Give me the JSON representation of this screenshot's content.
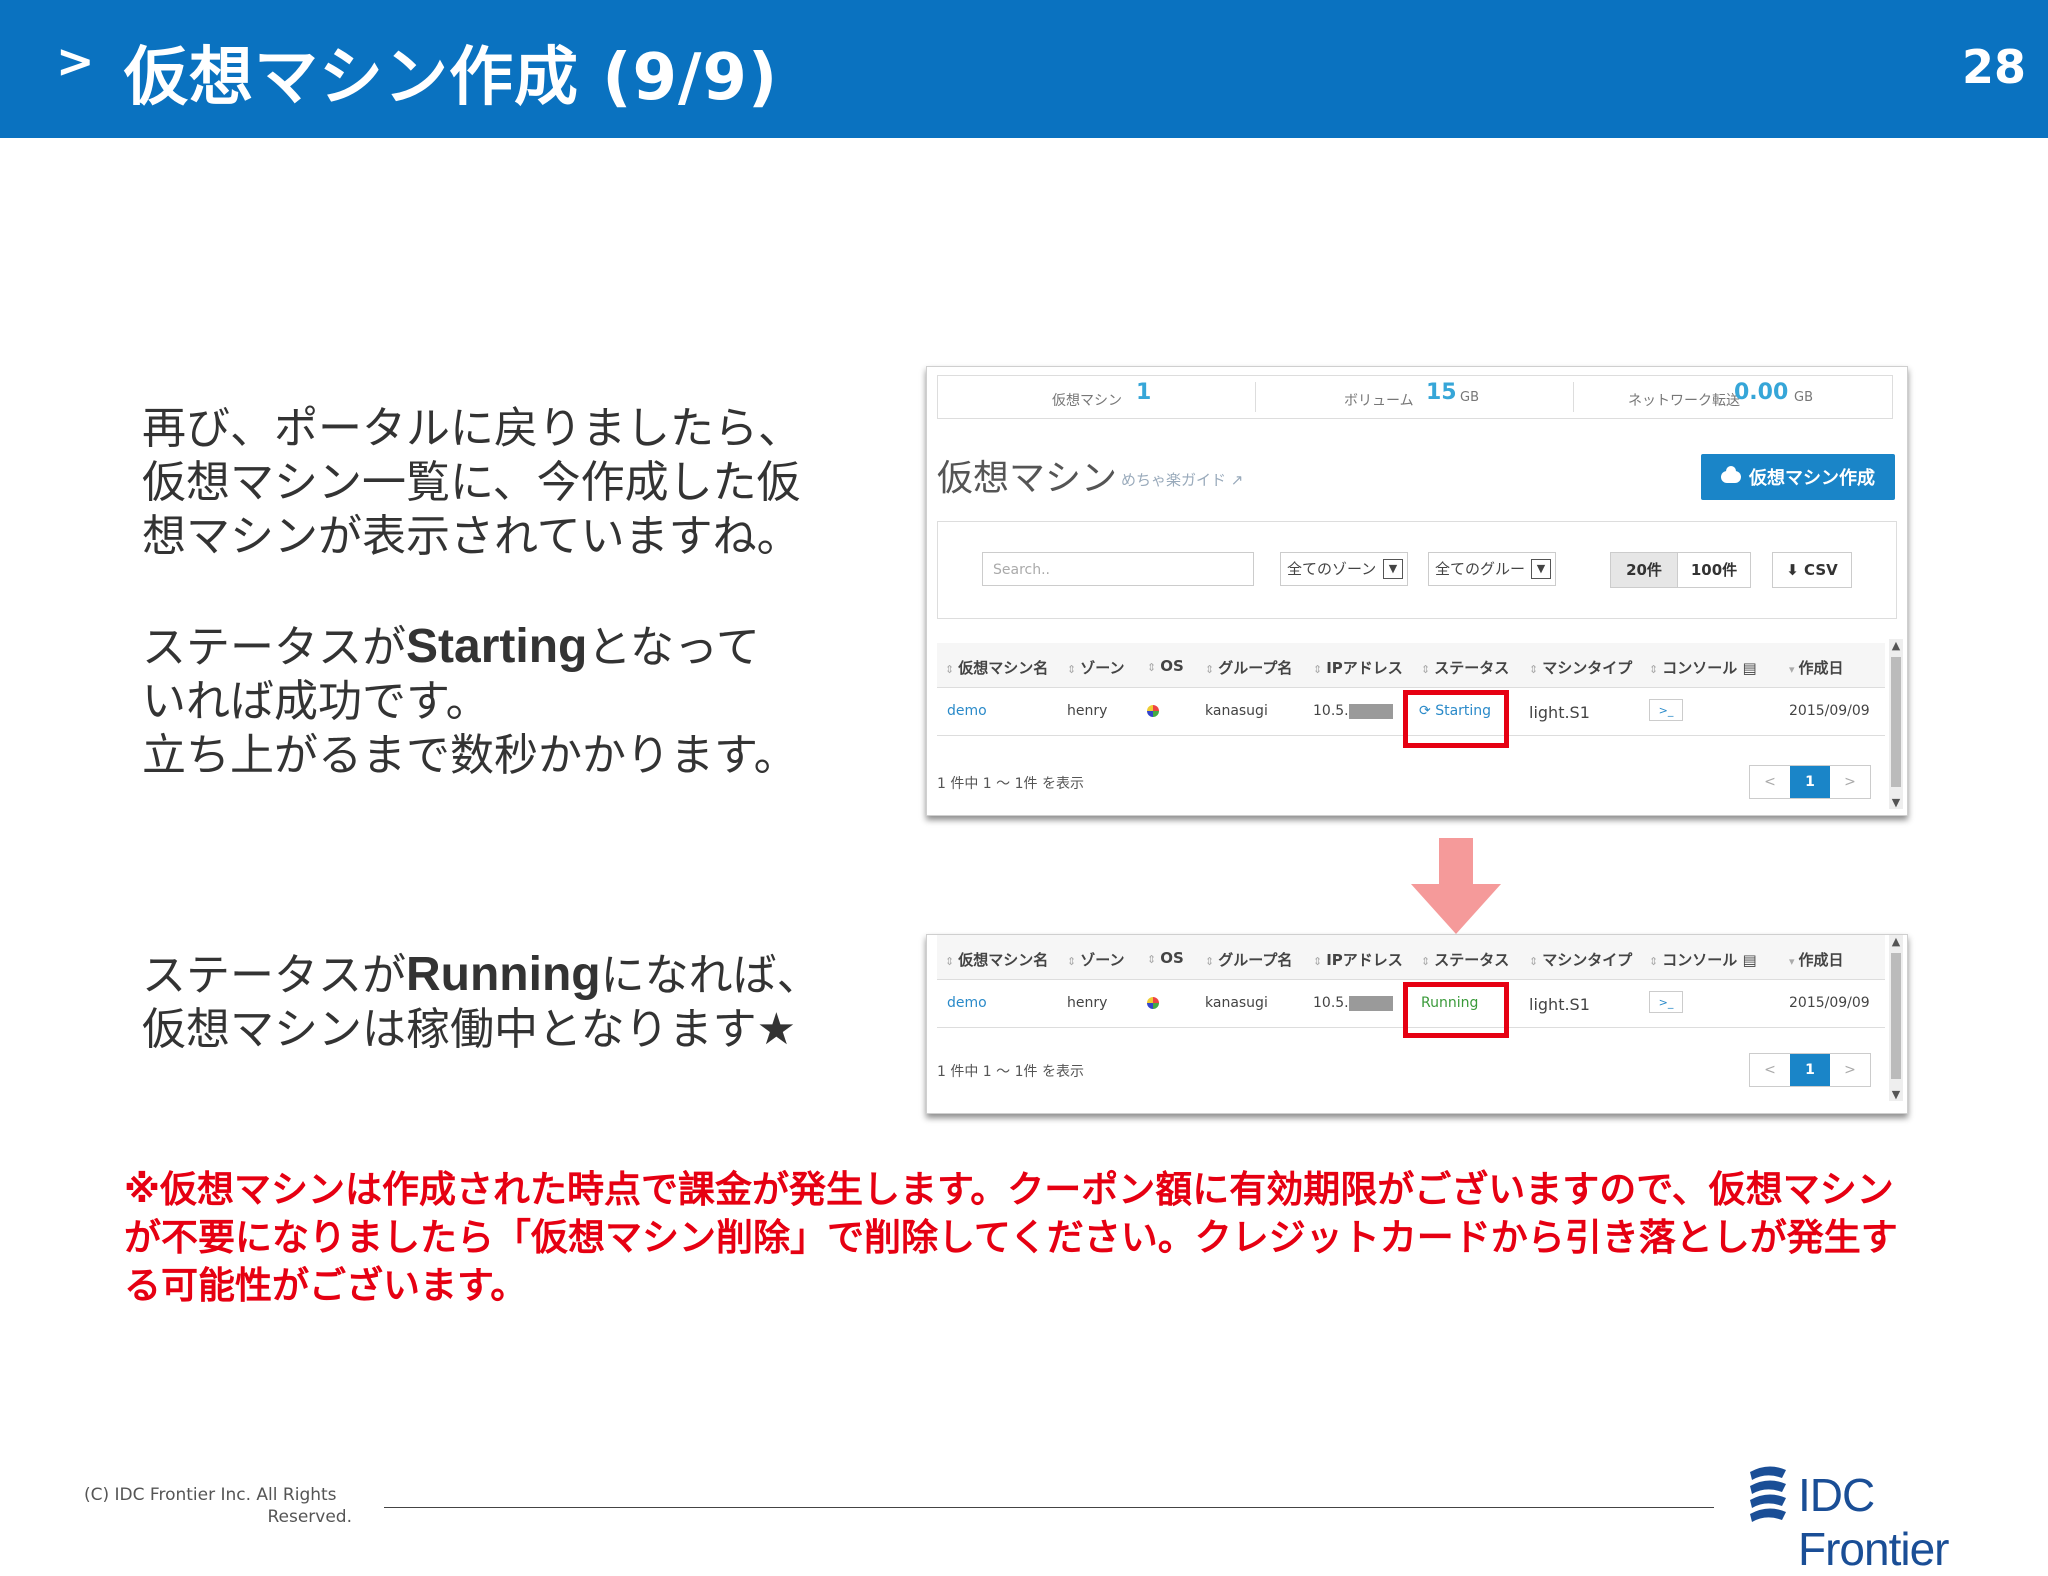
{
  "header": {
    "chevron": ">",
    "title": "仮想マシン作成 (9/9)",
    "page_number": "28"
  },
  "paragraphs": {
    "p1": [
      "再び、ポータルに戻りましたら、",
      "仮想マシン一覧に、今作成した仮",
      "想マシンが表示されていますね。"
    ],
    "p2": {
      "line1_pre": "ステータスが",
      "line1_bold": "Starting",
      "line1_post": "となって",
      "line2": "いれば成功です。",
      "line3": "立ち上がるまで数秒かかります。"
    },
    "p3": {
      "line1_pre": "ステータスが",
      "line1_bold": "Running",
      "line1_post": "になれば、",
      "line2": "仮想マシンは稼働中となります★"
    }
  },
  "note": "※仮想マシンは作成された時点で課金が発生します。クーポン額に有効期限がございますので、仮想マシンが不要になりましたら「仮想マシン削除」で削除してください。クレジットカードから引き落としが発生する可能性がございます。",
  "portal": {
    "stats": {
      "vm_label": "仮想マシン",
      "vm_value": "1",
      "volume_label": "ボリューム",
      "volume_value": "15",
      "volume_unit": "GB",
      "network_label": "ネットワーク転送",
      "network_value": "0.00",
      "network_unit": "GB"
    },
    "title": "仮想マシン",
    "guide_link": "めちゃ楽ガイド",
    "create_button": "仮想マシン作成",
    "search_placeholder": "Search..",
    "zone_select": "全てのゾーン",
    "group_select": "全てのグルー",
    "per_page_20": "20件",
    "per_page_100": "100件",
    "csv_button": "CSV",
    "columns": [
      "仮想マシン名",
      "ゾーン",
      "OS",
      "グループ名",
      "IPアドレス",
      "ステータス",
      "マシンタイプ",
      "コンソール",
      "作成日"
    ],
    "row": {
      "name": "demo",
      "zone": "henry",
      "group": "kanasugi",
      "ip": "10.5.",
      "machine_type": "light.S1",
      "created": "2015/09/09"
    },
    "status_starting": "Starting",
    "status_running": "Running",
    "count_text": "1 件中 1 ～ 1件 を表示",
    "pager": {
      "prev": "<",
      "current": "1",
      "next": ">"
    }
  },
  "footer": {
    "copyright_line1": "(C)   IDC Frontier Inc. All Rights",
    "copyright_line2": "Reserved.",
    "logo_text": "IDC Frontier"
  },
  "colors": {
    "header_bg": "#0a72c0",
    "note_red": "#e60012",
    "accent_blue": "#1a85c8"
  }
}
